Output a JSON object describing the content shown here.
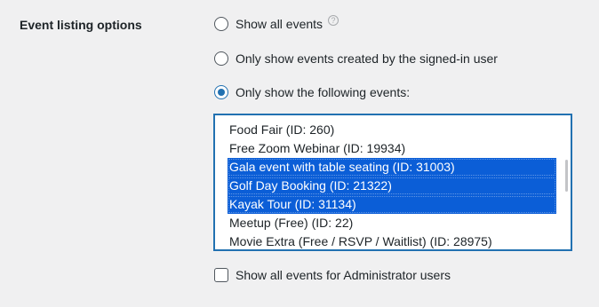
{
  "section": {
    "label": "Event listing options"
  },
  "options": {
    "show_all": "Show all events",
    "own_only": "Only show events created by the signed-in user",
    "following": "Only show the following events:"
  },
  "help_icon_glyph": "?",
  "events": [
    {
      "label": "Food Fair (ID: 260)",
      "selected": false
    },
    {
      "label": "Free Zoom Webinar (ID: 19934)",
      "selected": false
    },
    {
      "label": "Gala event with table seating (ID: 31003)",
      "selected": true
    },
    {
      "label": "Golf Day Booking (ID: 21322)",
      "selected": true
    },
    {
      "label": "Kayak Tour (ID: 31134)",
      "selected": true
    },
    {
      "label": "Meetup (Free) (ID: 22)",
      "selected": false
    },
    {
      "label": "Movie Extra (Free / RSVP / Waitlist) (ID: 28975)",
      "selected": false
    }
  ],
  "admin_checkbox_label": "Show all events for Administrator users",
  "colors": {
    "accent": "#2271b1",
    "selection": "#0b5ed7"
  }
}
